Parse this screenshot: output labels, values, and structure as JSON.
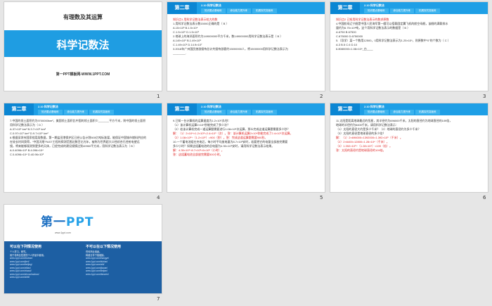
{
  "slide1": {
    "title": "有理数及其运算",
    "banner": "科学记数法",
    "footer": "第一PPT模板网-WWW.1PPT.COM",
    "number": "1"
  },
  "header": {
    "chapter": "第二章",
    "section": "2.10 科学记数法",
    "tabs": [
      "知识要点基础练",
      "综合能力提升练",
      "拓展探究突破练"
    ]
  },
  "slide2": {
    "number": "2",
    "lines": [
      {
        "t": "知识点1  用科学记数法表示较大的数",
        "red": true
      },
      {
        "t": "1.用科学记数法表示数15000正确的是（ B ）",
        "red": false
      },
      {
        "t": "A.15×10³        B.1.5×10⁴",
        "red": false
      },
      {
        "t": "C.1.5×10⁵        D.1.5×10³",
        "red": false
      },
      {
        "t": "2.地球上的海洋面积约为149000000平方千米，数149000000用科学记数法表示是（ B ）",
        "red": false
      },
      {
        "t": "A.149×10⁶    B.1.49×10⁸",
        "red": false
      },
      {
        "t": "C.1.49×10⁹    D.14.9×10⁷",
        "red": false
      },
      {
        "t": "3.2018年广州国民旅游接待总计共接待游客约15000000人，将15000000用科学记数法表示为",
        "red": false
      },
      {
        "t": "________.",
        "red": false
      }
    ]
  },
  "slide3": {
    "number": "3",
    "lines": [
      {
        "t": "知识点2  已知用科学记数法表示的数求原数",
        "red": true
      },
      {
        "t": "4.中国航母辽宁舰是中国人民海军第一艘可以搭载固定翼飞机的航空母舰，该舰的满载排水",
        "red": false
      },
      {
        "t": "量约为6.75×10⁴吨，这个用科学记数法表示的数据是（ B ）",
        "red": false
      },
      {
        "t": "A.6750      B.67500",
        "red": false
      },
      {
        "t": "C.675000    D.6750000",
        "red": false
      },
      {
        "t": "5.（导学）某一个数用12500，0用科学记数法表示为1.25×10ⁿ，则原数中“0”的个数为（ C ）",
        "red": false
      },
      {
        "t": "A.3       B.5       C.6       D.10",
        "red": false
      },
      {
        "t": "6.8080000=1.08×10⁴_白____",
        "red": false
      }
    ]
  },
  "slide4": {
    "number": "4",
    "lines": [
      {
        "t": "7.中国的领土面积约为9700000km²，美国领土面积比中国的领土面积少_______平方千米，则中国的领土面积",
        "red": false
      },
      {
        "t": "用科学记数法表示为（ D ）",
        "red": false
      },
      {
        "t": "A.37×10⁵ km²  B.3.7×10⁶ km²",
        "red": false
      },
      {
        "t": "C.0.97×10⁷ km²    D.9.7×10⁶ km²",
        "red": false
      },
      {
        "t": "8.根据深圳市国家档案局数据，第一期盐田港保护区已经公告计划500亿吨标准煤，能保证中国城市燃料供应的",
        "red": false
      },
      {
        "t": "在较长时间获得，“中国天眼”FAST工程的探测范围达数百亿光年，被称为世界超大口径综合孔径射电望远",
        "red": false
      },
      {
        "t": "镜，将来能够观测到更多的天体，已经完成的建设规模达到40960平方米，用科学记数法表示为（ B ）",
        "red": false
      },
      {
        "t": "A.0.4096×10⁵  B.4.096×10⁴",
        "red": false
      },
      {
        "t": "C.0.4096×10⁴  D.40.96×10³",
        "red": false
      }
    ]
  },
  "slide5": {
    "number": "5",
    "lines": [
      {
        "t": "9.已知一台计算机的运算速度为1.2×10⁵次/秒：",
        "red": false
      },
      {
        "t": "（1）该计算机运算2×10⁴秒能完成了多少次？",
        "red": false
      },
      {
        "t": "（2）若该计算机完成一道运算题需要进行1.08×10⁸次运算，那么完成这道运算题需要多少秒？",
        "red": false
      },
      {
        "t": "解：（1）2×10⁴×1.2×10⁵=2.4×10⁹（次）。答：该计算机运算2×10⁴秒能完成了2.4×10⁹次运算。",
        "red": true
      },
      {
        "t": "（2）1.08×10⁸÷（1.2×10⁵）=900（秒）。答：完成这道运算题需要900秒。",
        "red": true
      },
      {
        "t": "10.一个蓄电池组在充电后，每小时平均放电量为8.7×10³安时，若要把它的电量全部放完需要",
        "red": false
      },
      {
        "t": "多少小时？如果这组蓄电池的总电量为4.35×10⁶安时，请用科学记数法表示结果。",
        "red": false
      },
      {
        "t": "解：4.35×10⁶÷8.7×10³=5×10²（小时）。",
        "red": true
      },
      {
        "t": "答：这组蓄电池全部放完需要500小时。",
        "red": true
      }
    ]
  },
  "slide6": {
    "number": "6",
    "lines": [
      {
        "t": "11.太阳是距离地球最近的恒星，其半径约为696000千米，太阳的直径约为地球直径的109倍，",
        "red": false
      },
      {
        "t": "地球的半径约为6400千米，请用科学记数法表示：",
        "red": false
      },
      {
        "t": "（1）太阳的直径大约是多少千米？（2）地球的直径约为多少千米？",
        "red": false
      },
      {
        "t": "（3）太阳的直径是地球直径的多少倍？",
        "red": false
      },
      {
        "t": "解：（1）2×696000=1392000=1.392×10⁶（千米）。",
        "red": true
      },
      {
        "t": "（2）2×6400=12800=1.28×10⁴（千米）。",
        "red": true
      },
      {
        "t": "（3）1.392×10⁶÷（1.28×10⁴）≈109（倍）。",
        "red": true
      },
      {
        "t": "答：太阳的直径约是地球直径的109倍。",
        "red": true
      }
    ]
  },
  "slide7": {
    "number": "7",
    "logo_a": "第一",
    "logo_b": "PPT",
    "domain": "www.1ppt.com",
    "col1_head": "可以在下列情况使用",
    "col1_items": [
      "个人学习、研究。",
      "用于非商业性质的个人作品中使用。"
    ],
    "col2_head": "不可以在以下情况使用",
    "col2_items": [
      "任何商业用途。",
      "转载分享下载链接。"
    ],
    "links_a": [
      "www.1ppt.com/moban/",
      "www.1ppt.com/jieri/",
      "www.1ppt.com/beijing/",
      "www.1ppt.com/ziliao/",
      "www.1ppt.com/xiazai/",
      "www.1ppt.com/shouchaobao/",
      "www.1ppt.com/shiti/"
    ],
    "links_b": [
      "www.1ppt.com/hangye/",
      "www.1ppt.com/tubiao/",
      "www.1ppt.com/ziti/",
      "www.1ppt.com/jiaoan/",
      "www.1ppt.com/kejian/",
      "www.1ppt.com/fanwen/"
    ]
  }
}
